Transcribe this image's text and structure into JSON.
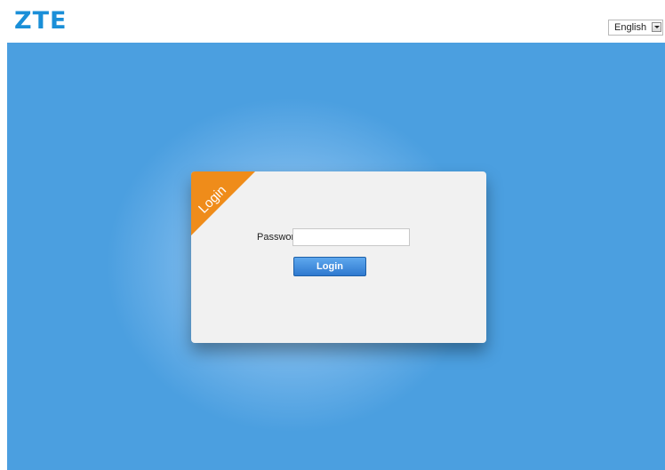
{
  "header": {
    "logo_text": "ZTE",
    "language": {
      "selected": "English"
    }
  },
  "login_panel": {
    "ribbon_label": "Login",
    "password_label": "Password",
    "password_value": "",
    "password_placeholder": "",
    "submit_label": "Login"
  },
  "colors": {
    "brand": "#1a8fd8",
    "background": "#4b9fe0",
    "ribbon": "#ef8c1a",
    "button": "#2f79cf"
  },
  "icons": {
    "language_dropdown": "chevron-down-icon"
  }
}
